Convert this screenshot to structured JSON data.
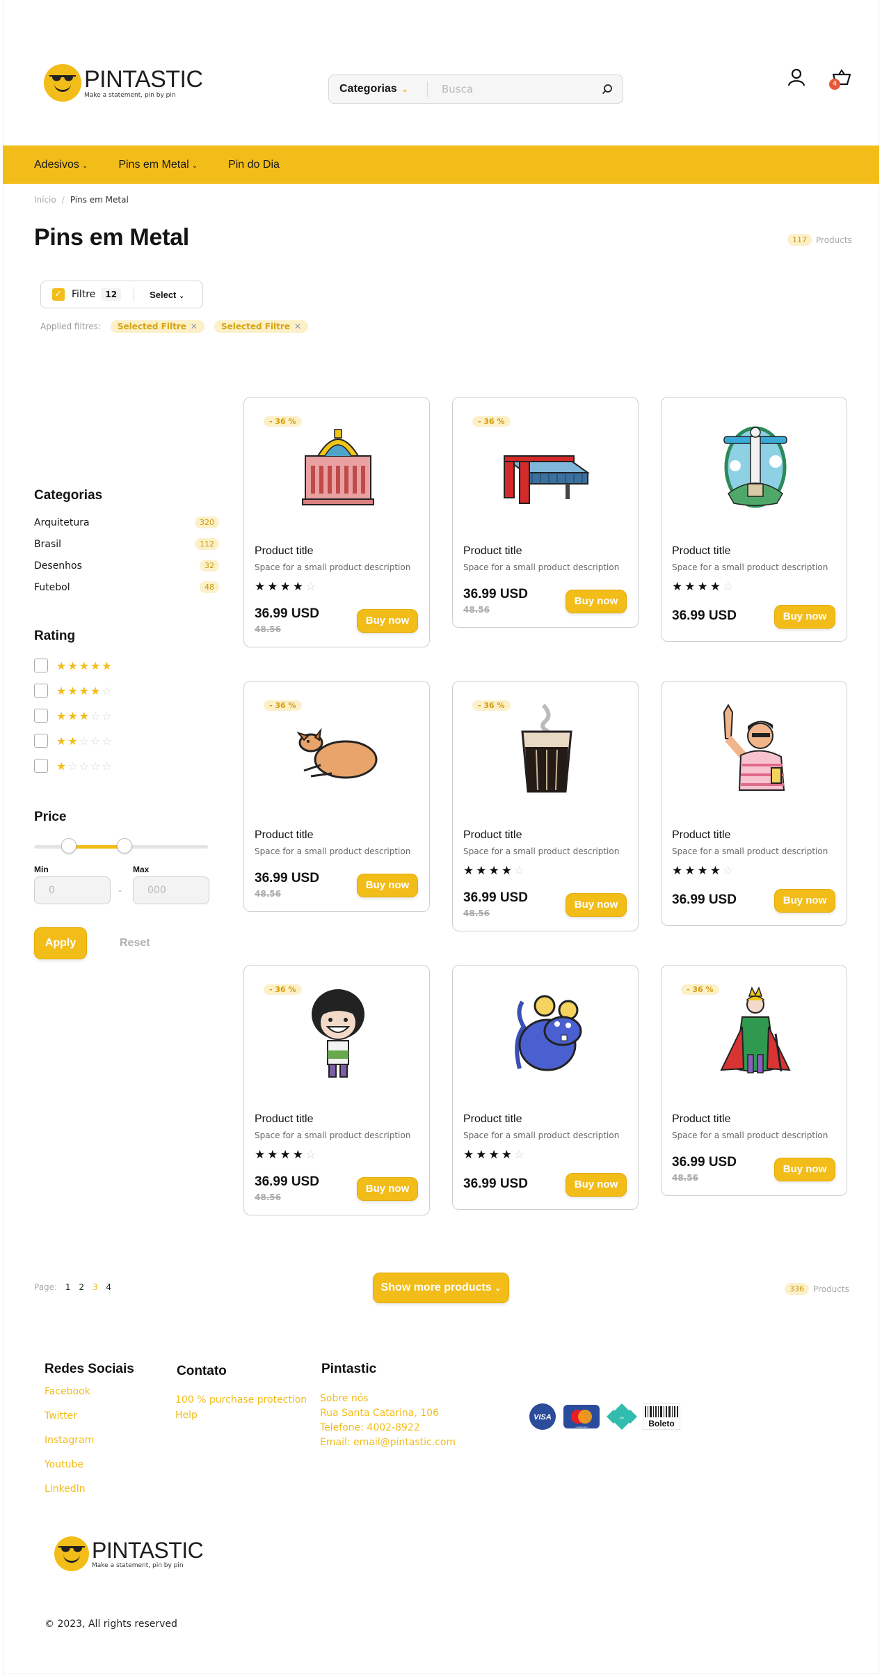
{
  "header": {
    "brand": "PINTASTIC",
    "tagline": "Make a statement, pin by pin",
    "search_category": "Categorias",
    "search_placeholder": "Busca",
    "cart_count": "4"
  },
  "nav": {
    "items": [
      {
        "label": "Adesivos",
        "dropdown": true
      },
      {
        "label": "Pins em Metal",
        "dropdown": true
      },
      {
        "label": "Pin do Dia",
        "dropdown": false
      }
    ]
  },
  "breadcrumb": {
    "home": "Início",
    "sep": "/",
    "current": "Pins em Metal"
  },
  "page": {
    "title": "Pins em Metal",
    "count": "117",
    "count_label": "Products"
  },
  "filter": {
    "label": "Filtre",
    "count": "12",
    "select_label": "Select",
    "applied_label": "Applied filtres:",
    "applied": [
      "Selected Filtre",
      "Selected Filtre"
    ]
  },
  "sidebar": {
    "categories_title": "Categorias",
    "categories": [
      {
        "name": "Arquitetura",
        "count": "320"
      },
      {
        "name": "Brasil",
        "count": "112"
      },
      {
        "name": "Desenhos",
        "count": "32"
      },
      {
        "name": "Futebol",
        "count": "48"
      }
    ],
    "rating_title": "Rating",
    "ratings": [
      5,
      4,
      3,
      2,
      1
    ],
    "price_title": "Price",
    "price_range_fraction": [
      0.2,
      0.52
    ],
    "min_label": "Min",
    "max_label": "Max",
    "min_placeholder": "0",
    "max_placeholder": "000",
    "dash": "-",
    "apply_label": "Apply",
    "reset_label": "Reset"
  },
  "products": [
    {
      "discount": "- 36 %",
      "title": "Product title",
      "desc": "Space for a small product description",
      "rating": 4,
      "price": "36.99 USD",
      "old_price": "48.56",
      "buy": "Buy now",
      "art": "theatre-pin"
    },
    {
      "discount": "- 36 %",
      "title": "Product title",
      "desc": "Space for a small product description",
      "rating": null,
      "price": "36.99 USD",
      "old_price": "48.56",
      "buy": "Buy now",
      "art": "museum-building-pin"
    },
    {
      "discount": null,
      "title": "Product title",
      "desc": "Space for a small product description",
      "rating": 4,
      "price": "36.99 USD",
      "old_price": null,
      "buy": "Buy now",
      "art": "christ-redeemer-pin"
    },
    {
      "discount": "- 36 %",
      "title": "Product title",
      "desc": "Space for a small product description",
      "rating": null,
      "price": "36.99 USD",
      "old_price": "48.56",
      "buy": "Buy now",
      "art": "dog-pin"
    },
    {
      "discount": "- 36 %",
      "title": "Product title",
      "desc": "Space for a small product description",
      "rating": 4,
      "price": "36.99 USD",
      "old_price": "48.56",
      "buy": "Buy now",
      "art": "coffee-glass-pin"
    },
    {
      "discount": null,
      "title": "Product title",
      "desc": "Space for a small product description",
      "rating": 4,
      "price": "36.99 USD",
      "old_price": null,
      "buy": "Buy now",
      "art": "thumbs-up-man-pin"
    },
    {
      "discount": "- 36 %",
      "title": "Product title",
      "desc": "Space for a small product description",
      "rating": 4,
      "price": "36.99 USD",
      "old_price": "48.56",
      "buy": "Buy now",
      "art": "cartoon-girl-pin"
    },
    {
      "discount": null,
      "title": "Product title",
      "desc": "Space for a small product description",
      "rating": 4,
      "price": "36.99 USD",
      "old_price": null,
      "buy": "Buy now",
      "art": "mouse-pin"
    },
    {
      "discount": "- 36 %",
      "title": "Product title",
      "desc": "Space for a small product description",
      "rating": null,
      "price": "36.99 USD",
      "old_price": "48.56",
      "buy": "Buy now",
      "art": "little-prince-pin"
    }
  ],
  "pagination": {
    "label": "Page:",
    "pages": [
      "1",
      "2",
      "3",
      "4"
    ],
    "active": "3",
    "show_more": "Show more products",
    "total": "336",
    "total_label": "Products"
  },
  "footer": {
    "social_title": "Redes Sociais",
    "social": [
      "Facebook",
      "Twitter",
      "Instagram",
      "Youtube",
      "LinkedIn"
    ],
    "contact_title": "Contato",
    "contact": [
      "100 % purchase protection",
      "Help"
    ],
    "brand_title": "Pintastic",
    "brand_lines": [
      "Sobre nós",
      "Rua Santa Catarina, 106",
      "Telefone: 4002-8922",
      "Email: email@pintastic.com"
    ],
    "payments": [
      "VISA",
      "mastercard",
      "pix",
      "Boleto"
    ],
    "copyright": "© 2023, All rights reserved"
  },
  "colors": {
    "accent": "#f2bc19",
    "accent_light": "#fcf0c9",
    "badge": "#e8573a",
    "text": "#151515"
  }
}
